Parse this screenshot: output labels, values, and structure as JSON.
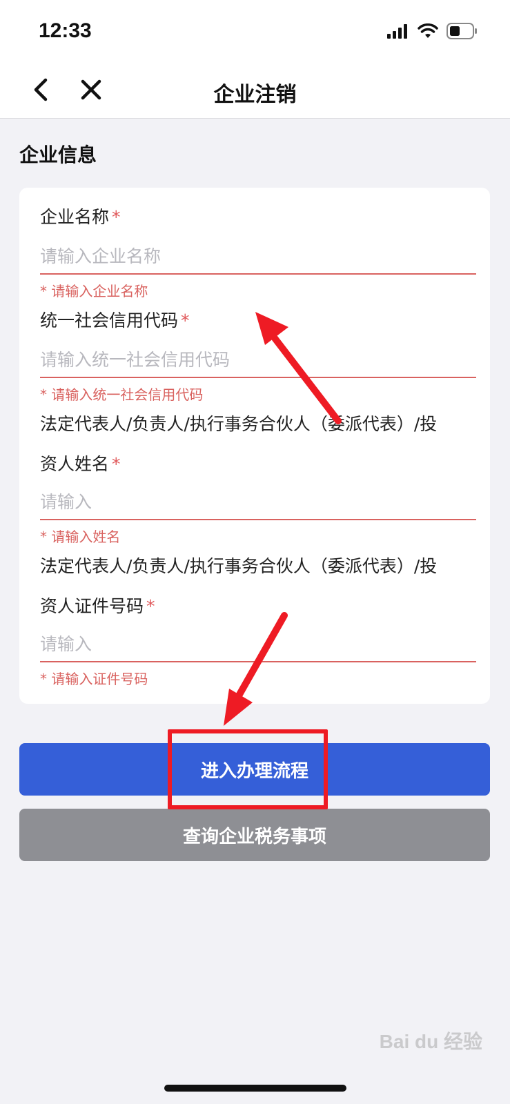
{
  "status_bar": {
    "time": "12:33",
    "icons": [
      "signal-icon",
      "wifi-icon",
      "battery-icon"
    ]
  },
  "nav": {
    "title": "企业注销",
    "back_icon": "chevron-left-icon",
    "close_icon": "close-icon"
  },
  "section": {
    "title": "企业信息"
  },
  "form": {
    "fields": [
      {
        "label": "企业名称",
        "required_mark": "*",
        "placeholder": "请输入企业名称",
        "value": "",
        "error": "* 请输入企业名称"
      },
      {
        "label": "统一社会信用代码",
        "required_mark": "*",
        "placeholder": "请输入统一社会信用代码",
        "value": "",
        "error": "* 请输入统一社会信用代码"
      },
      {
        "label_line1": "法定代表人/负责人/执行事务合伙人（委派代表）/投",
        "label_line2": "资人姓名",
        "required_mark": "*",
        "placeholder": "请输入",
        "value": "",
        "error": "* 请输入姓名"
      },
      {
        "label_line1": "法定代表人/负责人/执行事务合伙人（委派代表）/投",
        "label_line2": "资人证件号码",
        "required_mark": "*",
        "placeholder": "请输入",
        "value": "",
        "error": "* 请输入证件号码"
      }
    ]
  },
  "buttons": {
    "primary": "进入办理流程",
    "secondary": "查询企业税务事项"
  },
  "colors": {
    "primary_button": "#355fd8",
    "secondary_button": "#8e8f94",
    "error": "#d9625f",
    "annotation": "#ee1b24"
  },
  "watermark": "Bai du 经验"
}
